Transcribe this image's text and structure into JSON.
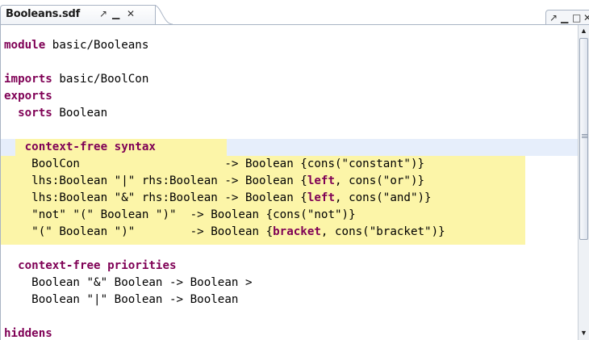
{
  "tab": {
    "title": "Booleans.sdf",
    "pin": "↗",
    "minimize": "▁",
    "close": "✕"
  },
  "view_controls": {
    "pin": "↗",
    "minimize": "▁",
    "maximize": "□",
    "close": "✕"
  },
  "code_lines": [
    [
      {
        "t": "module",
        "k": 1
      },
      {
        "t": " basic/Booleans",
        "k": 0
      }
    ],
    [],
    [
      {
        "t": "imports",
        "k": 1
      },
      {
        "t": " basic/BoolCon",
        "k": 0
      }
    ],
    [
      {
        "t": "exports",
        "k": 1
      }
    ],
    [
      {
        "t": "  ",
        "k": 0
      },
      {
        "t": "sorts",
        "k": 1
      },
      {
        "t": " Boolean",
        "k": 0
      }
    ],
    [],
    [
      {
        "t": "   ",
        "k": 0
      },
      {
        "t": "context-free syntax",
        "k": 1
      }
    ],
    [
      {
        "t": "    BoolCon                     -> Boolean {cons(\"constant\")}",
        "k": 0
      }
    ],
    [
      {
        "t": "    lhs:Boolean \"|\" rhs:Boolean -> Boolean {",
        "k": 0
      },
      {
        "t": "left",
        "k": 1
      },
      {
        "t": ", cons(\"or\")}",
        "k": 0
      }
    ],
    [
      {
        "t": "    lhs:Boolean \"&\" rhs:Boolean -> Boolean {",
        "k": 0
      },
      {
        "t": "left",
        "k": 1
      },
      {
        "t": ", cons(\"and\")}",
        "k": 0
      }
    ],
    [
      {
        "t": "    \"not\" \"(\" Boolean \")\"  -> Boolean {cons(\"not\")}",
        "k": 0
      }
    ],
    [
      {
        "t": "    \"(\" Boolean \")\"        -> Boolean {",
        "k": 0
      },
      {
        "t": "bracket",
        "k": 1
      },
      {
        "t": ", cons(\"bracket\")}",
        "k": 0
      }
    ],
    [],
    [
      {
        "t": "  ",
        "k": 0
      },
      {
        "t": "context-free priorities",
        "k": 1
      }
    ],
    [
      {
        "t": "    Boolean \"&\" Boolean -> Boolean >",
        "k": 0
      }
    ],
    [
      {
        "t": "    Boolean \"|\" Boolean -> Boolean",
        "k": 0
      }
    ],
    [],
    [
      {
        "t": "hiddens",
        "k": 1
      }
    ]
  ],
  "colors": {
    "keyword": "#7f0055",
    "highlight": "#fcf5a8",
    "current_line": "#e6eefb",
    "tab_border": "#a9b4c4"
  },
  "scrollbar": {
    "up": "▲",
    "down": "▼"
  }
}
